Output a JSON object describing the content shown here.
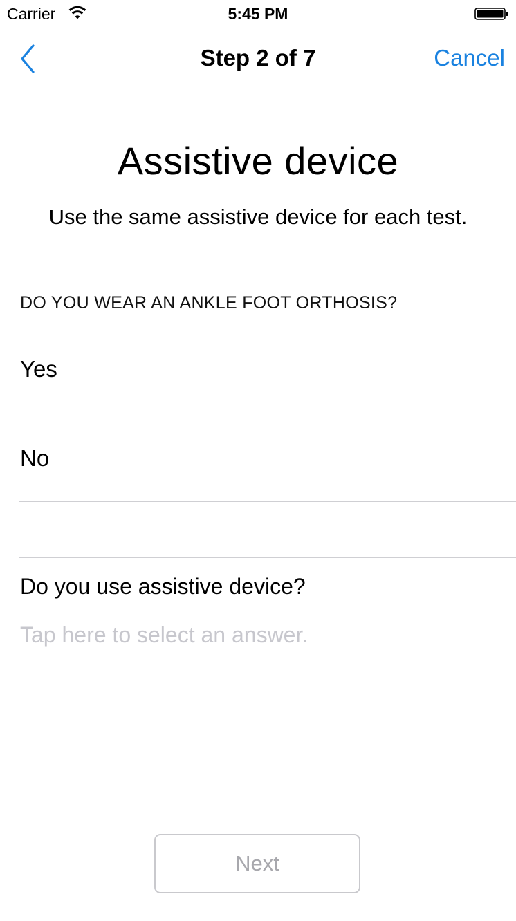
{
  "status_bar": {
    "carrier": "Carrier",
    "time": "5:45 PM",
    "wifi_icon": "wifi-icon",
    "battery_icon": "battery-icon"
  },
  "nav": {
    "back_icon": "chevron-left-icon",
    "title": "Step 2 of 7",
    "cancel_label": "Cancel",
    "accent_color": "#1a82e0"
  },
  "main": {
    "title": "Assistive device",
    "subtitle": "Use the same assistive device for each test.",
    "ankle_question": {
      "header": "DO YOU WEAR AN ANKLE FOOT ORTHOSIS?",
      "options": [
        {
          "label": "Yes"
        },
        {
          "label": "No"
        }
      ]
    },
    "device_question": {
      "label": "Do you use assistive device?",
      "placeholder": "Tap here to select an answer."
    }
  },
  "footer": {
    "next_label": "Next"
  }
}
